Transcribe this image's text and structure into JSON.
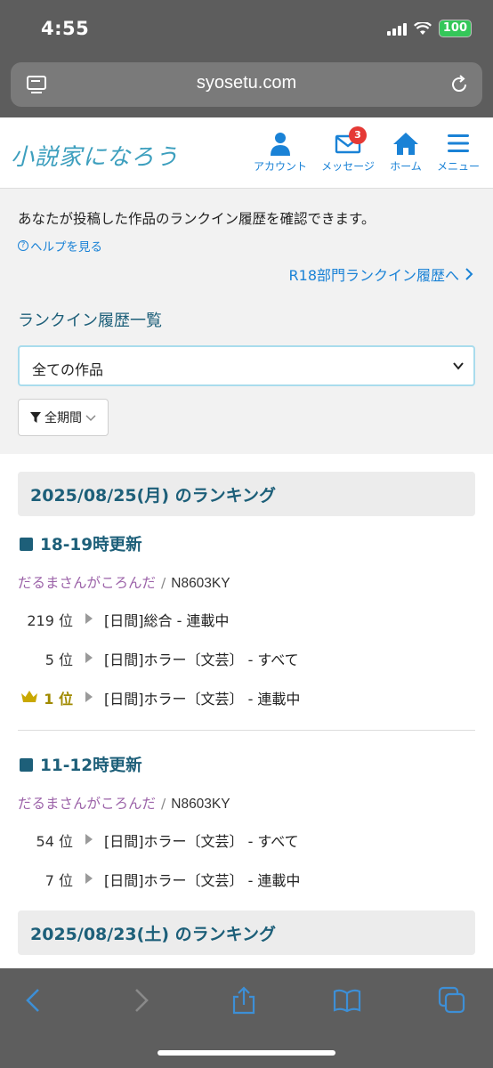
{
  "status_bar": {
    "time": "4:55",
    "battery": "100"
  },
  "browser": {
    "url": "syosetu.com"
  },
  "site": {
    "logo": "小説家になろう",
    "nav": [
      {
        "label": "アカウント",
        "icon": "person-icon"
      },
      {
        "label": "メッセージ",
        "icon": "mail-icon",
        "badge": "3"
      },
      {
        "label": "ホーム",
        "icon": "home-icon"
      },
      {
        "label": "メニュー",
        "icon": "menu-icon"
      }
    ]
  },
  "info": {
    "intro": "あなたが投稿した作品のランクイン履歴を確認できます。",
    "help": "ヘルプを見る",
    "r18_link": "R18部門ランクイン履歴へ",
    "section_title": "ランクイン履歴一覧",
    "select_value": "全ての作品",
    "period": "全期間"
  },
  "rankings": [
    {
      "date": "2025/08/25(月) のランキング",
      "updates": [
        {
          "time": "18-19時更新",
          "work_title": "だるまさんがころんだ",
          "work_code": "N8603KY",
          "ranks": [
            {
              "pos": "219 位",
              "category": "[日間]総合 - 連載中"
            },
            {
              "pos": "5 位",
              "category": "[日間]ホラー〔文芸〕 - すべて"
            },
            {
              "pos": "1 位",
              "category": "[日間]ホラー〔文芸〕 - 連載中"
            }
          ]
        },
        {
          "time": "11-12時更新",
          "work_title": "だるまさんがころんだ",
          "work_code": "N8603KY",
          "ranks": [
            {
              "pos": "54 位",
              "category": "[日間]ホラー〔文芸〕 - すべて"
            },
            {
              "pos": "7 位",
              "category": "[日間]ホラー〔文芸〕 - 連載中"
            }
          ]
        }
      ]
    },
    {
      "date": "2025/08/23(土) のランキング"
    }
  ],
  "colors": {
    "accent": "#1a82d6",
    "heading": "#1d5f79",
    "work_title": "#9b62a8",
    "crown": "#c9a800"
  }
}
